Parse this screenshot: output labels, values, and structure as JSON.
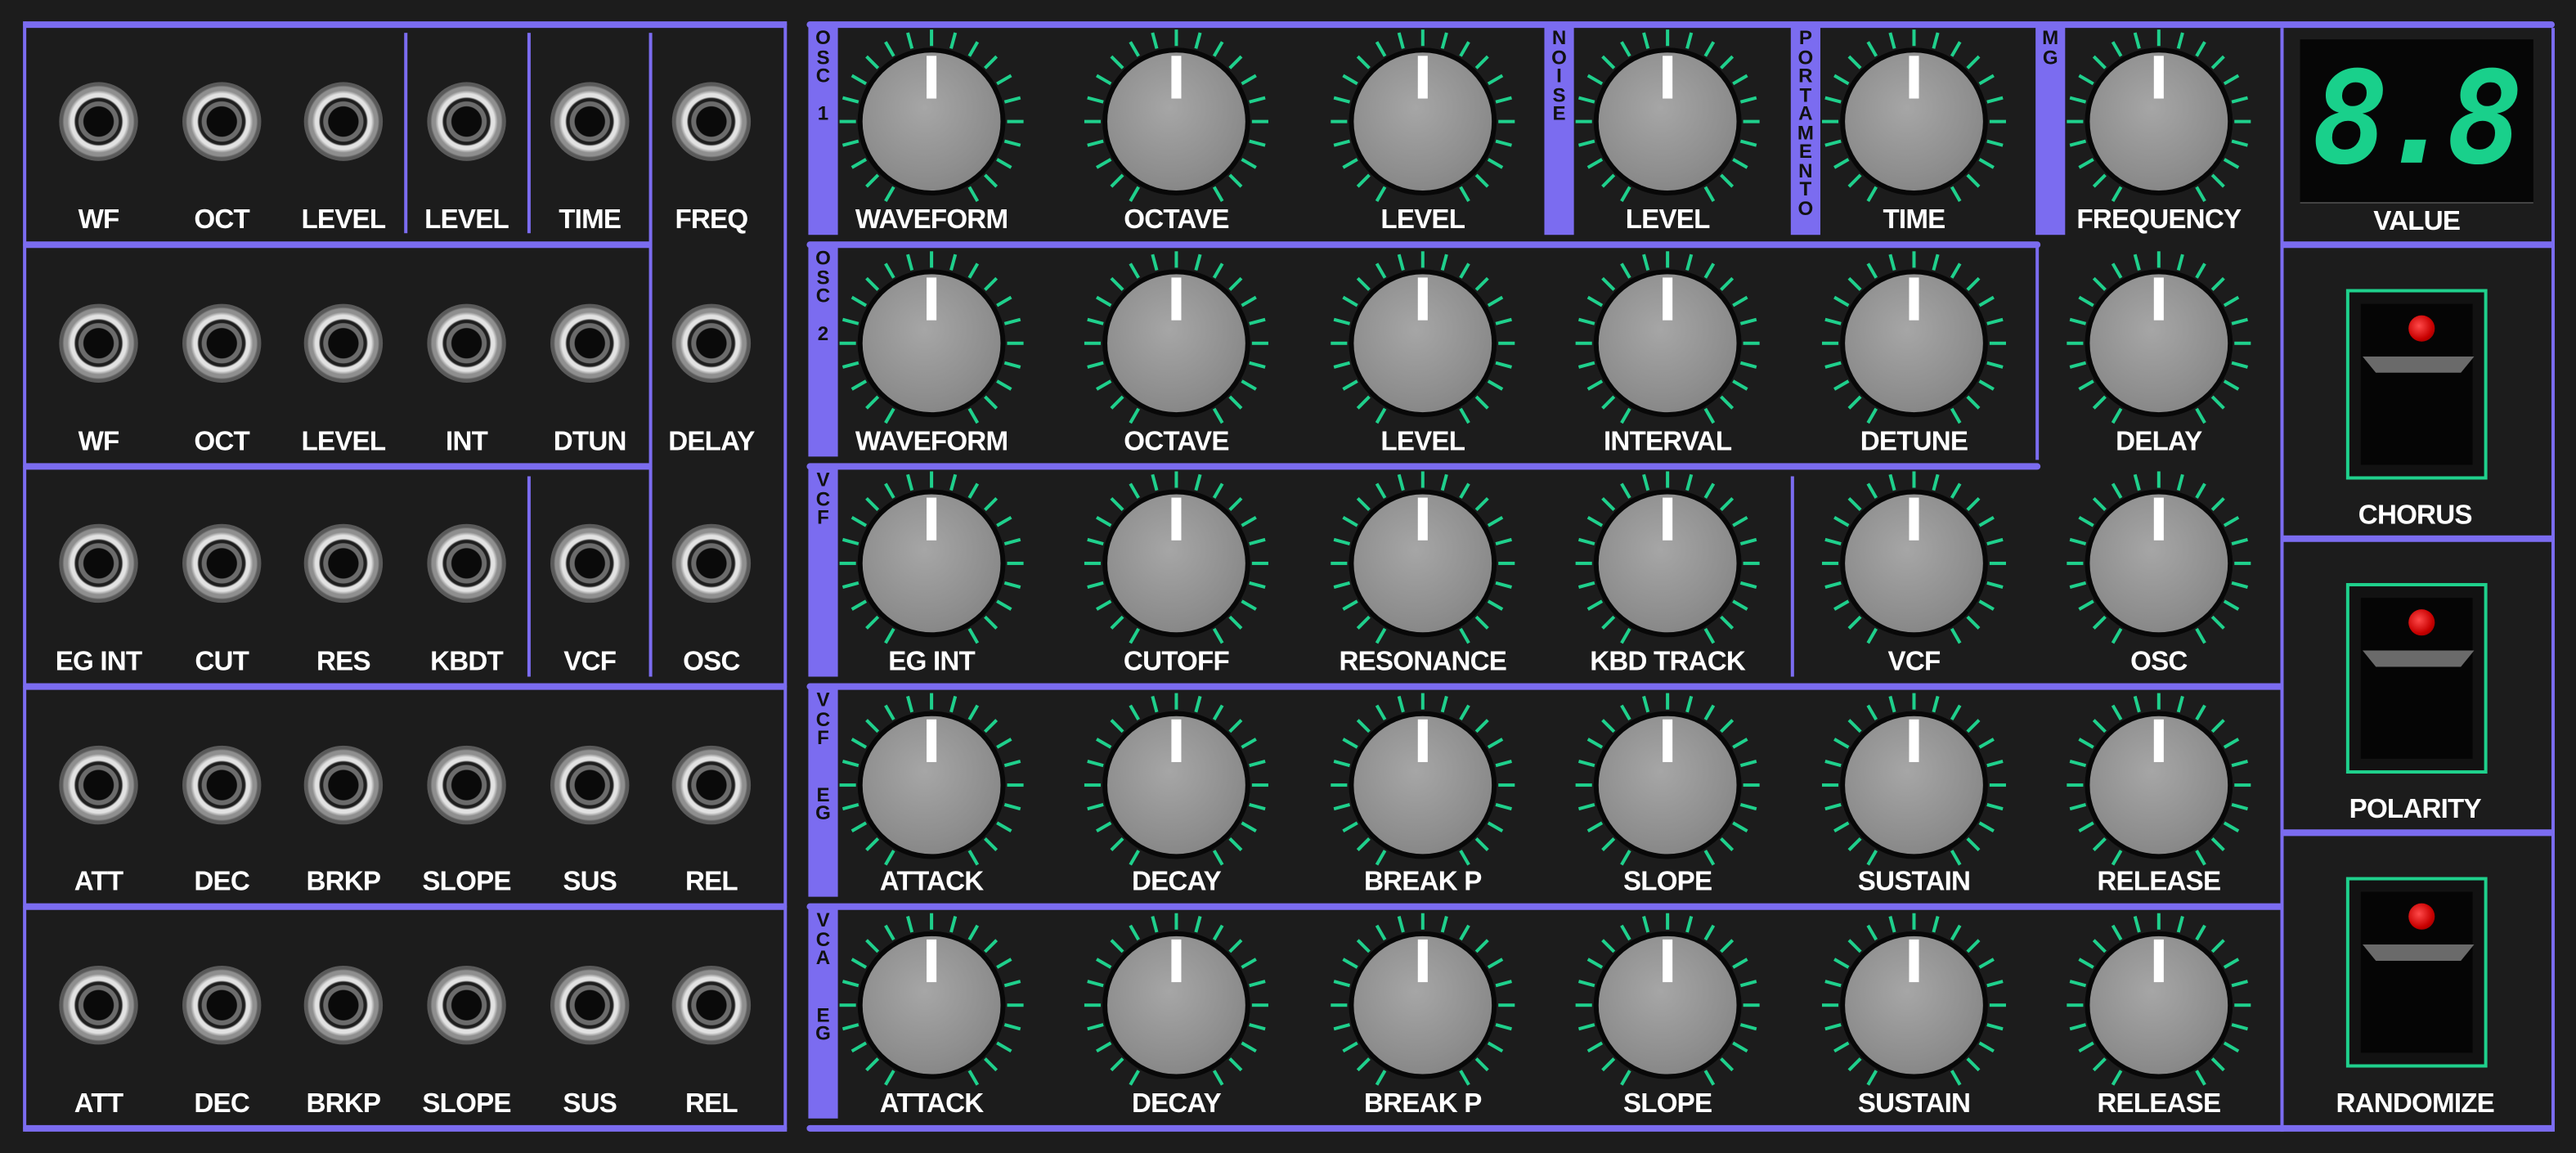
{
  "colors": {
    "background": "#1c1c1c",
    "accent": "#7b6cf0",
    "tick": "#1fd08c",
    "display": "#19d08b",
    "led": "#e00000"
  },
  "jack_rows": [
    [
      "WF",
      "OCT",
      "LEVEL",
      "LEVEL",
      "TIME",
      "FREQ"
    ],
    [
      "WF",
      "OCT",
      "LEVEL",
      "INT",
      "DTUN",
      "DELAY"
    ],
    [
      "EG INT",
      "CUT",
      "RES",
      "KBDT",
      "VCF",
      "OSC"
    ],
    [
      "ATT",
      "DEC",
      "BRKP",
      "SLOPE",
      "SUS",
      "REL"
    ],
    [
      "ATT",
      "DEC",
      "BRKP",
      "SLOPE",
      "SUS",
      "REL"
    ]
  ],
  "knob_rows": [
    [
      "WAVEFORM",
      "OCTAVE",
      "LEVEL",
      "LEVEL",
      "TIME",
      "FREQUENCY"
    ],
    [
      "WAVEFORM",
      "OCTAVE",
      "LEVEL",
      "INTERVAL",
      "DETUNE",
      "DELAY"
    ],
    [
      "EG INT",
      "CUTOFF",
      "RESONANCE",
      "KBD TRACK",
      "VCF",
      "OSC"
    ],
    [
      "ATTACK",
      "DECAY",
      "BREAK P",
      "SLOPE",
      "SUSTAIN",
      "RELEASE"
    ],
    [
      "ATTACK",
      "DECAY",
      "BREAK P",
      "SLOPE",
      "SUSTAIN",
      "RELEASE"
    ]
  ],
  "section_labels": {
    "osc1": "O\nS\nC\n \n1",
    "noise": "N\nO\nI\nS\nE",
    "portamento": "P\nO\nR\nT\nA\nM\nE\nN\nT\nO",
    "mg": "M\nG",
    "osc2": "O\nS\nC\n \n2",
    "vcf": "V\nC\nF",
    "vcf_eg": "V\nC\nF\n \n \nE\nG",
    "vca_eg": "V\nC\nA\n \n \nE\nG"
  },
  "display": {
    "value": "8.8",
    "label": "VALUE"
  },
  "buttons": [
    {
      "label": "CHORUS"
    },
    {
      "label": "POLARITY"
    },
    {
      "label": "RANDOMIZE"
    }
  ]
}
